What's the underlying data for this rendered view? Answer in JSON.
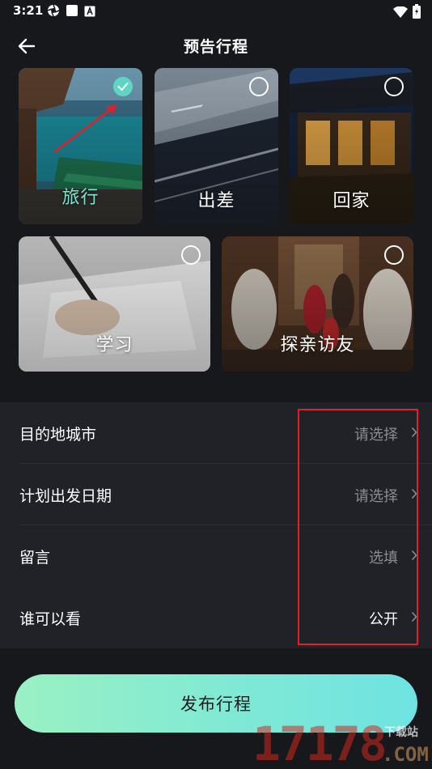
{
  "status_bar": {
    "time": "3:21"
  },
  "header": {
    "title": "预告行程"
  },
  "categories": [
    {
      "label": "旅行",
      "selected": true
    },
    {
      "label": "出差",
      "selected": false
    },
    {
      "label": "回家",
      "selected": false
    },
    {
      "label": "学习",
      "selected": false
    },
    {
      "label": "探亲访友",
      "selected": false
    }
  ],
  "form": {
    "rows": [
      {
        "label": "目的地城市",
        "value": "请选择"
      },
      {
        "label": "计划出发日期",
        "value": "请选择"
      },
      {
        "label": "留言",
        "value": "选填"
      },
      {
        "label": "谁可以看",
        "value": "公开"
      }
    ]
  },
  "publish": {
    "label": "发布行程"
  },
  "watermark": {
    "digits": "17178",
    "site_cn": "下载站",
    "domain": ".COM"
  },
  "colors": {
    "accent": "#5fd6c4",
    "selected_label": "#7ee3cf",
    "highlight_box": "#e0202a"
  }
}
